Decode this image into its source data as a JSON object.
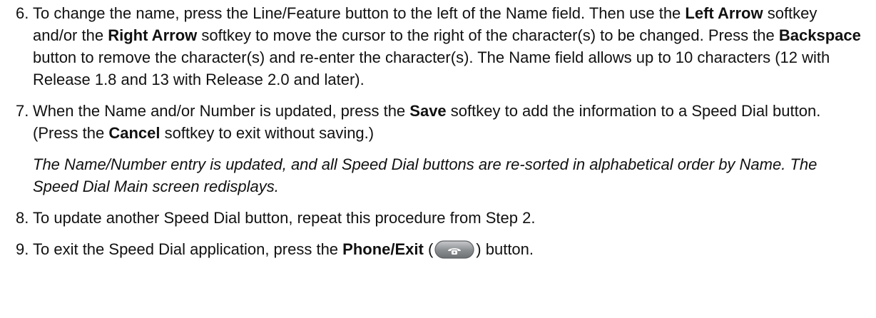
{
  "steps": [
    {
      "number": "6.",
      "parts": [
        {
          "t": "To change the name, press the Line/Feature button to the left of the Name field. Then use the "
        },
        {
          "b": "Left Arrow"
        },
        {
          "t": " softkey and/or the "
        },
        {
          "b": "Right Arrow"
        },
        {
          "t": " softkey to move the cursor to the right of the character(s) to be changed. Press the "
        },
        {
          "b": "Backspace"
        },
        {
          "t": " button to remove the character(s) and re-enter the character(s). The Name field allows up to 10 characters (12 with Release 1.8 and 13 with Release 2.0 and later)."
        }
      ]
    },
    {
      "number": "7.",
      "parts": [
        {
          "t": "When the Name and/or Number is updated, press the "
        },
        {
          "b": "Save"
        },
        {
          "t": " softkey to add the information to a Speed Dial button. (Press the "
        },
        {
          "b": "Cancel"
        },
        {
          "t": " softkey to exit without saving.)"
        }
      ],
      "result": "The Name/Number entry is updated, and all Speed Dial buttons are re-sorted in alphabetical order by Name. The Speed Dial Main screen redisplays."
    },
    {
      "number": "8.",
      "parts": [
        {
          "t": "To update another Speed Dial button, repeat this procedure from Step 2."
        }
      ]
    },
    {
      "number": "9.",
      "parts": [
        {
          "t": "To exit the Speed Dial application, press the "
        },
        {
          "b": "Phone/Exit"
        },
        {
          "t": " ("
        },
        {
          "icon": "phone-button-icon"
        },
        {
          "t": ") button."
        }
      ]
    }
  ],
  "colors": {
    "text": "#111111",
    "icon_fill": "#8a8d90",
    "icon_border": "#5e6164"
  }
}
